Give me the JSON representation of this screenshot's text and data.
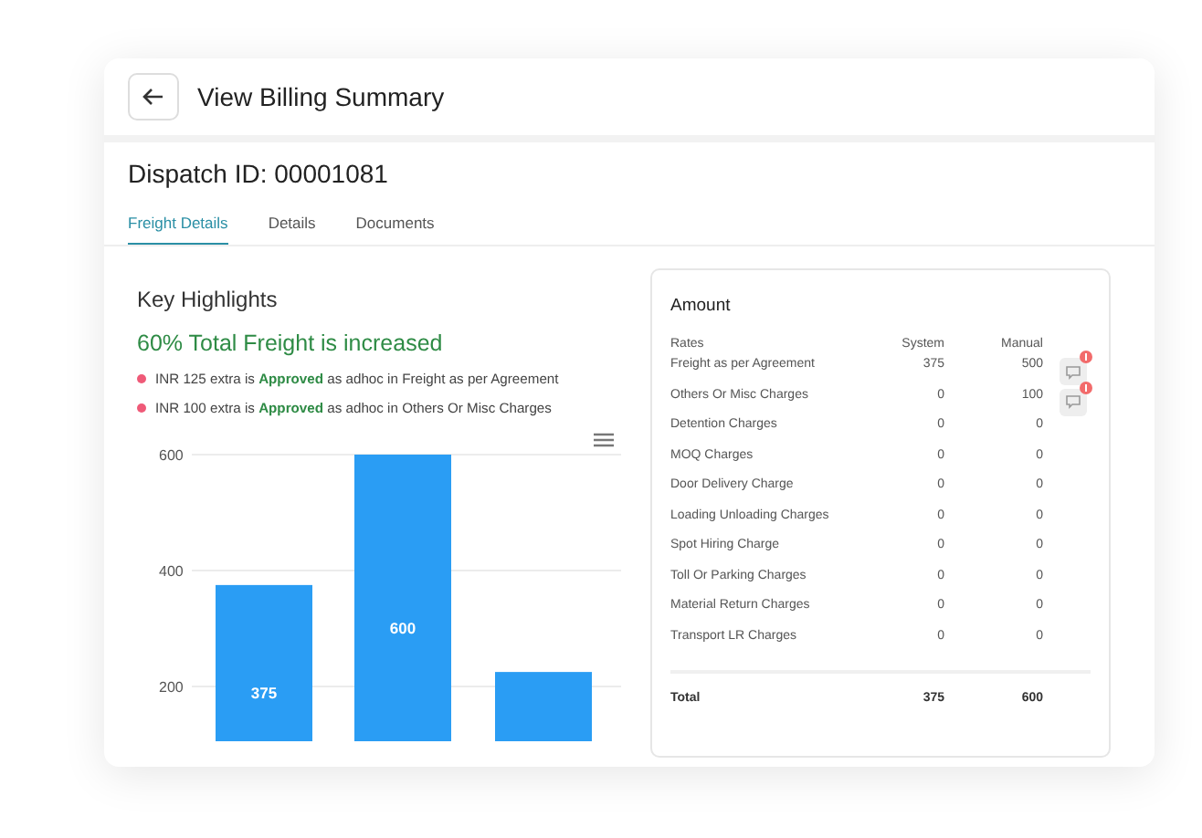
{
  "header": {
    "title": "View Billing Summary"
  },
  "dispatch": {
    "label": "Dispatch ID: 00001081"
  },
  "tabs": [
    {
      "label": "Freight Details",
      "selected": true
    },
    {
      "label": "Details",
      "selected": false
    },
    {
      "label": "Documents",
      "selected": false
    }
  ],
  "highlights": {
    "title": "Key Highlights",
    "headline": "60% Total Freight is increased",
    "items": [
      "INR 125 extra is **Approved** as adhoc in Freight as per Agreement",
      "INR 100 extra is **Approved** as adhoc in Others Or Misc Charges"
    ]
  },
  "chart_data": {
    "type": "bar",
    "values": [
      375,
      600,
      225
    ],
    "ylim": [
      0,
      600
    ],
    "yticks": [
      200,
      400,
      600
    ],
    "value_labels": [
      "375",
      "600",
      null
    ]
  },
  "amount": {
    "title": "Amount",
    "columns": [
      "Rates",
      "System",
      "Manual"
    ],
    "rows": [
      {
        "rate": "Freight as per Agreement",
        "system": "375",
        "manual": "500",
        "comment": true
      },
      {
        "rate": "Others Or Misc Charges",
        "system": "0",
        "manual": "100",
        "comment": true
      },
      {
        "rate": "Detention Charges",
        "system": "0",
        "manual": "0",
        "comment": false
      },
      {
        "rate": "MOQ Charges",
        "system": "0",
        "manual": "0",
        "comment": false
      },
      {
        "rate": "Door Delivery Charge",
        "system": "0",
        "manual": "0",
        "comment": false
      },
      {
        "rate": "Loading Unloading Charges",
        "system": "0",
        "manual": "0",
        "comment": false
      },
      {
        "rate": "Spot Hiring Charge",
        "system": "0",
        "manual": "0",
        "comment": false
      },
      {
        "rate": "Toll Or Parking Charges",
        "system": "0",
        "manual": "0",
        "comment": false
      },
      {
        "rate": "Material Return Charges",
        "system": "0",
        "manual": "0",
        "comment": false
      },
      {
        "rate": "Transport LR Charges",
        "system": "0",
        "manual": "0",
        "comment": false
      }
    ],
    "total": {
      "label": "Total",
      "system": "375",
      "manual": "600"
    }
  }
}
